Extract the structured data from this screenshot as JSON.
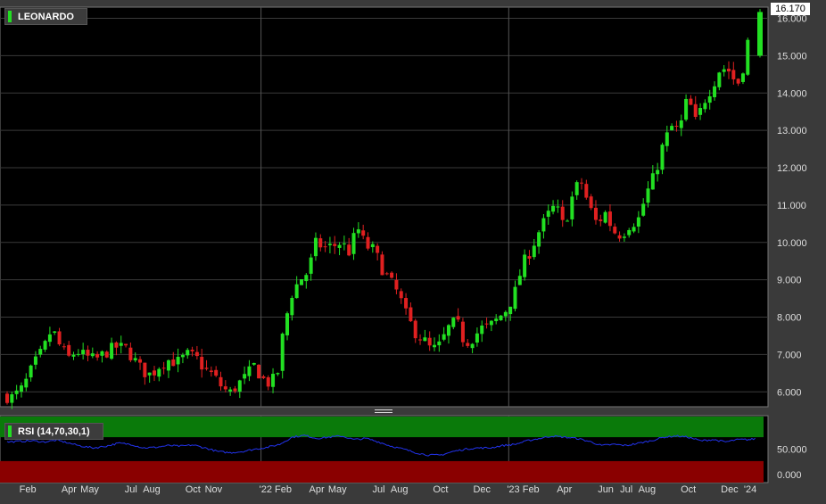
{
  "chart_data": {
    "type": "candlestick",
    "title": "LEONARDO",
    "last_price": "16.170",
    "y_ticks": [
      "6.000",
      "7.000",
      "8.000",
      "9.000",
      "10.000",
      "11.000",
      "12.000",
      "13.000",
      "14.000",
      "15.000",
      "16.000"
    ],
    "ylim": [
      5.6,
      16.3
    ],
    "x_ticks": [
      {
        "label": "Feb",
        "t": 1
      },
      {
        "label": "Apr",
        "t": 3
      },
      {
        "label": "May",
        "t": 4
      },
      {
        "label": "Jul",
        "t": 6
      },
      {
        "label": "Aug",
        "t": 7
      },
      {
        "label": "Oct",
        "t": 9
      },
      {
        "label": "Nov",
        "t": 10
      },
      {
        "label": "'22 Feb",
        "t": 13
      },
      {
        "label": "Apr",
        "t": 15
      },
      {
        "label": "May",
        "t": 16
      },
      {
        "label": "Jul",
        "t": 18
      },
      {
        "label": "Aug",
        "t": 19
      },
      {
        "label": "Oct",
        "t": 21
      },
      {
        "label": "Dec",
        "t": 23
      },
      {
        "label": "'23 Feb",
        "t": 25
      },
      {
        "label": "Apr",
        "t": 27
      },
      {
        "label": "Jun",
        "t": 29
      },
      {
        "label": "Jul",
        "t": 30
      },
      {
        "label": "Aug",
        "t": 31
      },
      {
        "label": "Oct",
        "t": 33
      },
      {
        "label": "Dec",
        "t": 35
      },
      {
        "label": "'24",
        "t": 36
      }
    ],
    "x_range_months": [
      0,
      36.3
    ],
    "grid": true,
    "price_series": [
      [
        0.0,
        5.9
      ],
      [
        0.5,
        5.85
      ],
      [
        1.0,
        6.1
      ],
      [
        1.5,
        6.7
      ],
      [
        2.0,
        7.15
      ],
      [
        2.4,
        7.7
      ],
      [
        2.8,
        7.2
      ],
      [
        3.2,
        6.9
      ],
      [
        3.6,
        7.1
      ],
      [
        4.0,
        6.95
      ],
      [
        4.5,
        6.85
      ],
      [
        5.0,
        7.05
      ],
      [
        5.5,
        7.2
      ],
      [
        6.0,
        7.15
      ],
      [
        6.4,
        6.85
      ],
      [
        6.8,
        6.55
      ],
      [
        7.2,
        6.45
      ],
      [
        7.6,
        6.7
      ],
      [
        8.0,
        6.85
      ],
      [
        8.5,
        6.8
      ],
      [
        9.0,
        7.0
      ],
      [
        9.4,
        6.9
      ],
      [
        9.8,
        6.6
      ],
      [
        10.2,
        6.45
      ],
      [
        10.6,
        6.15
      ],
      [
        11.0,
        5.95
      ],
      [
        11.4,
        6.2
      ],
      [
        11.8,
        6.4
      ],
      [
        12.2,
        6.7
      ],
      [
        12.6,
        6.35
      ],
      [
        13.0,
        6.2
      ],
      [
        13.4,
        6.6
      ],
      [
        13.6,
        7.6
      ],
      [
        14.0,
        8.6
      ],
      [
        14.4,
        9.0
      ],
      [
        14.8,
        9.2
      ],
      [
        15.2,
        10.0
      ],
      [
        15.6,
        9.85
      ],
      [
        16.0,
        9.9
      ],
      [
        16.4,
        10.0
      ],
      [
        16.8,
        9.75
      ],
      [
        17.2,
        10.4
      ],
      [
        17.6,
        9.9
      ],
      [
        18.0,
        9.8
      ],
      [
        18.4,
        9.3
      ],
      [
        18.8,
        8.95
      ],
      [
        19.2,
        8.6
      ],
      [
        19.6,
        8.0
      ],
      [
        20.0,
        7.6
      ],
      [
        20.4,
        7.4
      ],
      [
        20.8,
        7.1
      ],
      [
        21.2,
        7.25
      ],
      [
        21.6,
        7.7
      ],
      [
        22.0,
        7.9
      ],
      [
        22.4,
        7.3
      ],
      [
        22.8,
        7.45
      ],
      [
        23.2,
        7.7
      ],
      [
        23.6,
        7.75
      ],
      [
        24.0,
        7.95
      ],
      [
        24.4,
        8.2
      ],
      [
        24.8,
        8.6
      ],
      [
        25.2,
        9.4
      ],
      [
        25.6,
        9.8
      ],
      [
        26.0,
        10.3
      ],
      [
        26.4,
        10.7
      ],
      [
        26.8,
        11.0
      ],
      [
        27.2,
        10.4
      ],
      [
        27.6,
        11.2
      ],
      [
        28.0,
        11.7
      ],
      [
        28.4,
        11.0
      ],
      [
        28.8,
        10.5
      ],
      [
        29.2,
        10.8
      ],
      [
        29.6,
        10.3
      ],
      [
        30.0,
        10.2
      ],
      [
        30.4,
        10.5
      ],
      [
        30.8,
        10.6
      ],
      [
        31.2,
        11.3
      ],
      [
        31.6,
        11.8
      ],
      [
        32.0,
        12.6
      ],
      [
        32.4,
        13.1
      ],
      [
        32.8,
        13.0
      ],
      [
        33.2,
        13.9
      ],
      [
        33.6,
        13.2
      ],
      [
        34.0,
        13.8
      ],
      [
        34.4,
        14.2
      ],
      [
        34.8,
        14.7
      ],
      [
        35.2,
        14.6
      ],
      [
        35.6,
        14.2
      ],
      [
        36.0,
        14.9
      ],
      [
        36.3,
        16.17
      ]
    ],
    "rsi": {
      "label": "RSI (14,70,30,1)",
      "y_ticks": [
        "0.000",
        "50.000"
      ],
      "ylim": [
        0,
        100
      ],
      "upper": 70,
      "lower": 30,
      "series": [
        [
          0.0,
          62
        ],
        [
          0.6,
          63
        ],
        [
          1.2,
          64
        ],
        [
          1.8,
          62
        ],
        [
          2.4,
          65
        ],
        [
          3.0,
          60
        ],
        [
          3.6,
          55
        ],
        [
          4.2,
          52
        ],
        [
          4.8,
          55
        ],
        [
          5.4,
          60
        ],
        [
          6.0,
          58
        ],
        [
          6.6,
          52
        ],
        [
          7.2,
          53
        ],
        [
          7.8,
          56
        ],
        [
          8.4,
          55
        ],
        [
          9.0,
          57
        ],
        [
          9.6,
          52
        ],
        [
          10.2,
          46
        ],
        [
          10.8,
          44
        ],
        [
          11.4,
          46
        ],
        [
          12.0,
          50
        ],
        [
          12.6,
          53
        ],
        [
          13.2,
          58
        ],
        [
          13.8,
          70
        ],
        [
          14.4,
          73
        ],
        [
          15.0,
          68
        ],
        [
          15.6,
          70
        ],
        [
          16.2,
          72
        ],
        [
          16.8,
          66
        ],
        [
          17.4,
          68
        ],
        [
          18.0,
          62
        ],
        [
          18.6,
          55
        ],
        [
          19.2,
          50
        ],
        [
          19.8,
          44
        ],
        [
          20.4,
          40
        ],
        [
          21.0,
          40
        ],
        [
          21.6,
          46
        ],
        [
          22.2,
          50
        ],
        [
          22.8,
          52
        ],
        [
          23.4,
          52
        ],
        [
          24.0,
          56
        ],
        [
          24.6,
          58
        ],
        [
          25.2,
          64
        ],
        [
          25.8,
          68
        ],
        [
          26.4,
          72
        ],
        [
          27.0,
          70
        ],
        [
          27.6,
          68
        ],
        [
          28.2,
          63
        ],
        [
          28.8,
          56
        ],
        [
          29.4,
          58
        ],
        [
          30.0,
          56
        ],
        [
          30.6,
          60
        ],
        [
          31.2,
          64
        ],
        [
          31.8,
          70
        ],
        [
          32.4,
          72
        ],
        [
          33.0,
          70
        ],
        [
          33.6,
          64
        ],
        [
          34.2,
          66
        ],
        [
          34.8,
          62
        ],
        [
          35.4,
          66
        ],
        [
          36.0,
          66
        ],
        [
          36.3,
          68
        ]
      ]
    }
  },
  "colors": {
    "up": "#22e022",
    "down": "#e02020",
    "background": "#000000",
    "grid": "#3a3a3a",
    "rsi_line": "#2233ee",
    "rsi_upper_band": "#0a7a0a",
    "rsi_lower_band": "#8a0000"
  }
}
